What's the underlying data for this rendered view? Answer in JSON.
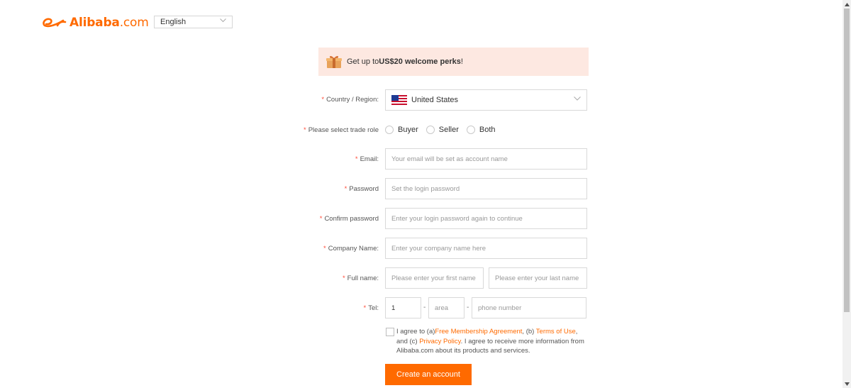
{
  "header": {
    "logo_bold": "Alibaba",
    "logo_suffix": ".com",
    "language": "English",
    "brand_color": "#ff6a00"
  },
  "perks": {
    "prefix": "Get up to ",
    "amount": "US$20 welcome perks",
    "suffix": "!",
    "icon": "gift-icon"
  },
  "form": {
    "country": {
      "label": "Country / Region:",
      "value": "United States",
      "flag": "us-flag-icon"
    },
    "trade_role": {
      "label": "Please select trade role",
      "options": [
        "Buyer",
        "Seller",
        "Both"
      ]
    },
    "email": {
      "label": "Email:",
      "placeholder": "Your email will be set as account name"
    },
    "password": {
      "label": "Password",
      "placeholder": "Set the login password"
    },
    "confirm_password": {
      "label": "Confirm password",
      "placeholder": "Enter your login password again to continue"
    },
    "company": {
      "label": "Company Name:",
      "placeholder": "Enter your company name here"
    },
    "full_name": {
      "label": "Full name:",
      "first_placeholder": "Please enter your first name",
      "last_placeholder": "Please enter your last name"
    },
    "tel": {
      "label": "Tel:",
      "country_code": "1",
      "area_placeholder": "area",
      "phone_placeholder": "phone number",
      "separator": "-"
    },
    "required_mark": "*"
  },
  "agreement": {
    "t1": "I agree to (a)",
    "link1": "Free Membership Agreement",
    "t2": ", (b) ",
    "link2": "Terms of Use",
    "t3": ", and (c) ",
    "link3": "Privacy Policy",
    "t4": ". I agree to receive more information from Alibaba.com about its products and services."
  },
  "submit": {
    "label": "Create an account"
  }
}
